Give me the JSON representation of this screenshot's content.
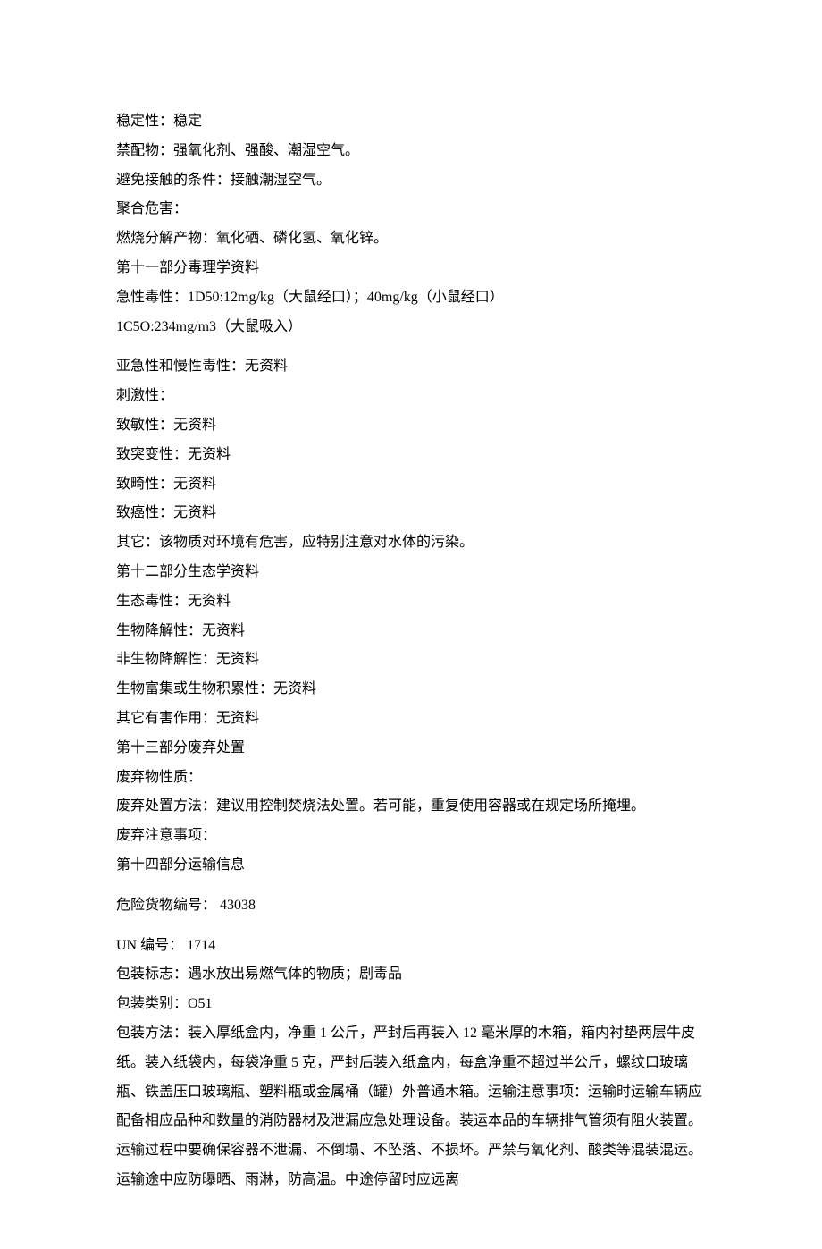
{
  "lines": [
    "稳定性：稳定",
    "禁配物：强氧化剂、强酸、潮湿空气。",
    "避免接触的条件：接触潮湿空气。",
    "聚合危害：",
    "燃烧分解产物：氧化硒、磷化氢、氧化锌。",
    "第十一部分毒理学资料",
    "急性毒性：1D50:12mg/kg（大鼠经口）；40mg/kg（小鼠经口）",
    "1C5O:234mg/m3（大鼠吸入）",
    "",
    "亚急性和慢性毒性：无资料",
    "刺激性：",
    "致敏性：无资料",
    "致突变性：无资料",
    "致畸性：无资料",
    "致癌性：无资料",
    "其它：该物质对环境有危害，应特别注意对水体的污染。",
    "第十二部分生态学资料",
    "生态毒性：无资料",
    "生物降解性：无资料",
    "非生物降解性：无资料",
    "生物富集或生物积累性：无资料",
    "其它有害作用：无资料",
    "第十三部分废弃处置",
    "废弃物性质：",
    "废弃处置方法：建议用控制焚烧法处置。若可能，重复使用容器或在规定场所掩埋。",
    "废弃注意事项：",
    "第十四部分运输信息",
    "危险货物编号： 43038",
    "UN 编号： 1714",
    "包装标志：遇水放出易燃气体的物质；剧毒品",
    "包装类别：O51",
    "包装方法：装入厚纸盒内，净重 1 公斤，严封后再装入 12 毫米厚的木箱，箱内衬垫两层牛皮纸。装入纸袋内，每袋净重 5 克，严封后装入纸盒内，每盒净重不超过半公斤，螺纹口玻璃瓶、铁盖压口玻璃瓶、塑料瓶或金属桶（罐）外普通木箱。运输注意事项：运输时运输车辆应配备相应品种和数量的消防器材及泄漏应急处理设备。装运本品的车辆排气管须有阻火装置。运输过程中要确保容器不泄漏、不倒塌、不坠落、不损坏。严禁与氧化剂、酸类等混装混运。运输途中应防曝晒、雨淋，防高温。中途停留时应远离"
  ],
  "gapAfter": [
    7,
    26,
    27,
    28
  ]
}
